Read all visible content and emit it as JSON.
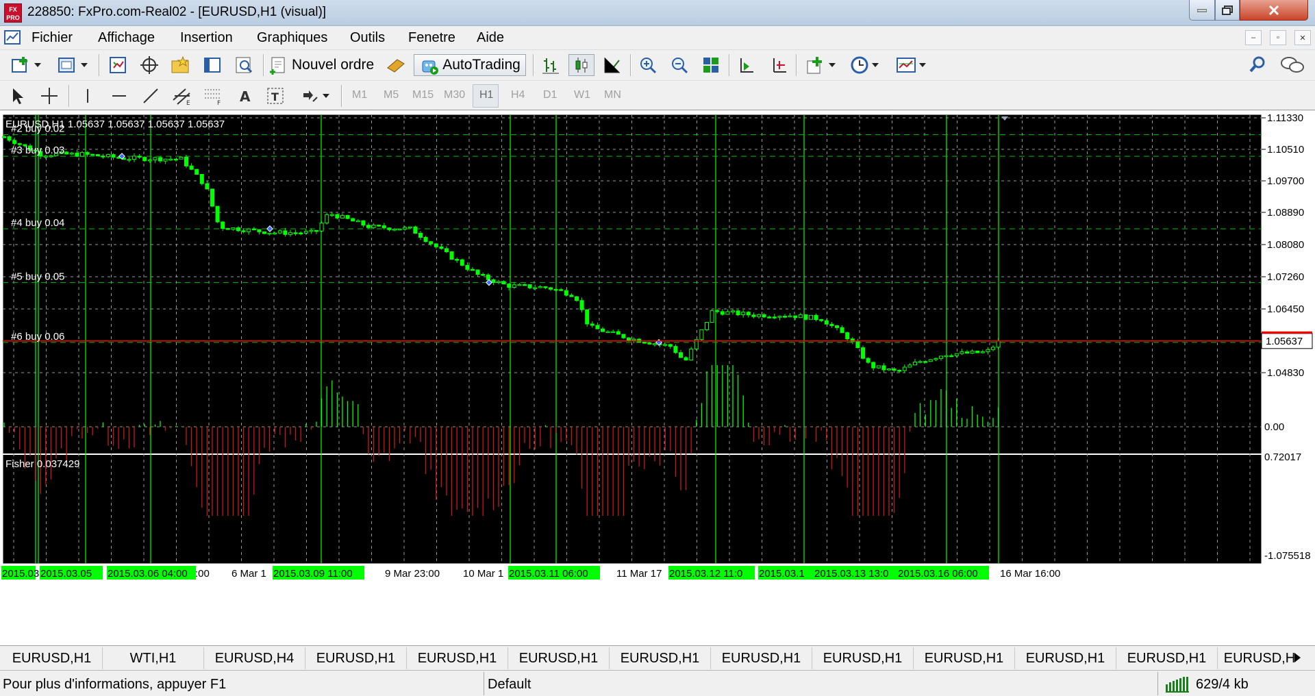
{
  "window": {
    "title": "228850: FxPro.com-Real02 - [EURUSD,H1 (visual)]",
    "logo": "FX PRO"
  },
  "menu": [
    "Fichier",
    "Affichage",
    "Insertion",
    "Graphiques",
    "Outils",
    "Fenetre",
    "Aide"
  ],
  "toolbar": {
    "new_order_label": "Nouvel ordre",
    "autotrading_label": "AutoTrading"
  },
  "timeframes": [
    "M1",
    "M5",
    "M15",
    "M30",
    "H1",
    "H4",
    "D1",
    "W1",
    "MN"
  ],
  "active_timeframe": "H1",
  "chart": {
    "symbol_line": "EURUSD,H1  1.05637 1.05637 1.05637 1.05637",
    "current_price": "1.05637",
    "price_axis": [
      "1.11330",
      "1.10510",
      "1.09700",
      "1.08890",
      "1.08080",
      "1.07260",
      "1.06450",
      "1.05637",
      "1.04830"
    ],
    "orders": [
      {
        "label": "#2 buy 0.02",
        "price": 1.109
      },
      {
        "label": "#3 buy 0.03",
        "price": 1.1035
      },
      {
        "label": "#4 buy 0.04",
        "price": 1.085
      },
      {
        "label": "#5 buy 0.05",
        "price": 1.0713
      },
      {
        "label": "#6 buy 0.06",
        "price": 1.056
      }
    ],
    "indicator": {
      "name_line": "Fisher 0.037429",
      "axis": [
        "0.72017",
        "0.00",
        "-1.075518"
      ]
    },
    "time_labels": [
      {
        "text": "2015.03.0",
        "hl": true
      },
      {
        "text": "2015.03.05",
        "hl": true
      },
      {
        "text": "2015.03.06 04:00",
        "hl": true
      },
      {
        "text": ":00",
        "hl": false
      },
      {
        "text": "6 Mar 1",
        "hl": false
      },
      {
        "text": "2015.03.09 11:00",
        "hl": true
      },
      {
        "text": "9 Mar 23:00",
        "hl": false
      },
      {
        "text": "10 Mar 1",
        "hl": false
      },
      {
        "text": "2015.03.11 06:00",
        "hl": true
      },
      {
        "text": "11 Mar 17",
        "hl": false
      },
      {
        "text": "2015.03.12 11:0",
        "hl": true
      },
      {
        "text": "2015.03.1",
        "hl": true
      },
      {
        "text": "2015.03.13 13:0",
        "hl": true
      },
      {
        "text": "2015.03.16 06:00",
        "hl": true
      },
      {
        "text": "16 Mar 16:00",
        "hl": false
      }
    ],
    "colors": {
      "background": "#000000",
      "bull": "#00ff00",
      "bear": "#ff0000",
      "grid": "#c8c8c8",
      "highlight": "#00ff00",
      "price_line": "#ff0000"
    }
  },
  "tabs": [
    "EURUSD,H1",
    "WTI,H1",
    "EURUSD,H4",
    "EURUSD,H1",
    "EURUSD,H1",
    "EURUSD,H1",
    "EURUSD,H1",
    "EURUSD,H1",
    "EURUSD,H1",
    "EURUSD,H1",
    "EURUSD,H1",
    "EURUSD,H1",
    "EURUSD,H"
  ],
  "status": {
    "help": "Pour plus d'informations, appuyer F1",
    "profile": "Default",
    "traffic": "629/4 kb"
  }
}
